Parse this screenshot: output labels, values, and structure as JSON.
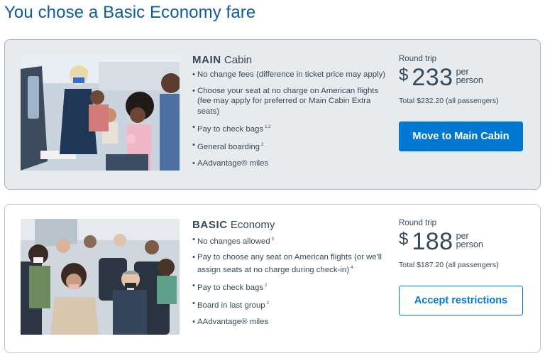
{
  "page": {
    "title": "You chose a Basic Economy fare"
  },
  "main_cabin": {
    "title_strong": "MAIN",
    "title_rest": "Cabin",
    "photo_alt": "Flight attendant assisting masked passengers in the cabin",
    "features": [
      {
        "text": "No change fees (difference in ticket price may apply)",
        "sup": ""
      },
      {
        "text": "Choose your seat at no charge on American flights (fee may apply for preferred or Main Cabin Extra seats)",
        "sup": ""
      },
      {
        "text": "Pay to check bags",
        "sup": "1,2"
      },
      {
        "text": "General boarding",
        "sup": "2"
      },
      {
        "text": "AAdvantage® miles",
        "sup": ""
      }
    ],
    "trip_label": "Round trip",
    "currency": "$",
    "amount": "233",
    "per_line1": "per",
    "per_line2": "person",
    "total": "Total $232.20 (all passengers)",
    "button_label": "Move to Main Cabin"
  },
  "basic_economy": {
    "title_strong": "BASIC",
    "title_rest": "Economy",
    "photo_alt": "Masked passengers seated in an aircraft cabin",
    "features": [
      {
        "text": "No changes allowed",
        "sup": "3"
      },
      {
        "text": "Pay to choose any seat on American flights (or we'll assign seats at no charge during check-in)",
        "sup": "4"
      },
      {
        "text": "Pay to check bags",
        "sup": "2"
      },
      {
        "text": "Board in last group",
        "sup": "2"
      },
      {
        "text": "AAdvantage® miles",
        "sup": ""
      }
    ],
    "trip_label": "Round trip",
    "currency": "$",
    "amount": "188",
    "per_line1": "per",
    "per_line2": "person",
    "total": "Total $187.20 (all passengers)",
    "button_label": "Accept restrictions"
  },
  "colors": {
    "brand_blue": "#0078d2",
    "title_blue": "#0e5a9e",
    "text": "#36495a",
    "card_main_bg": "#e7ebee"
  }
}
